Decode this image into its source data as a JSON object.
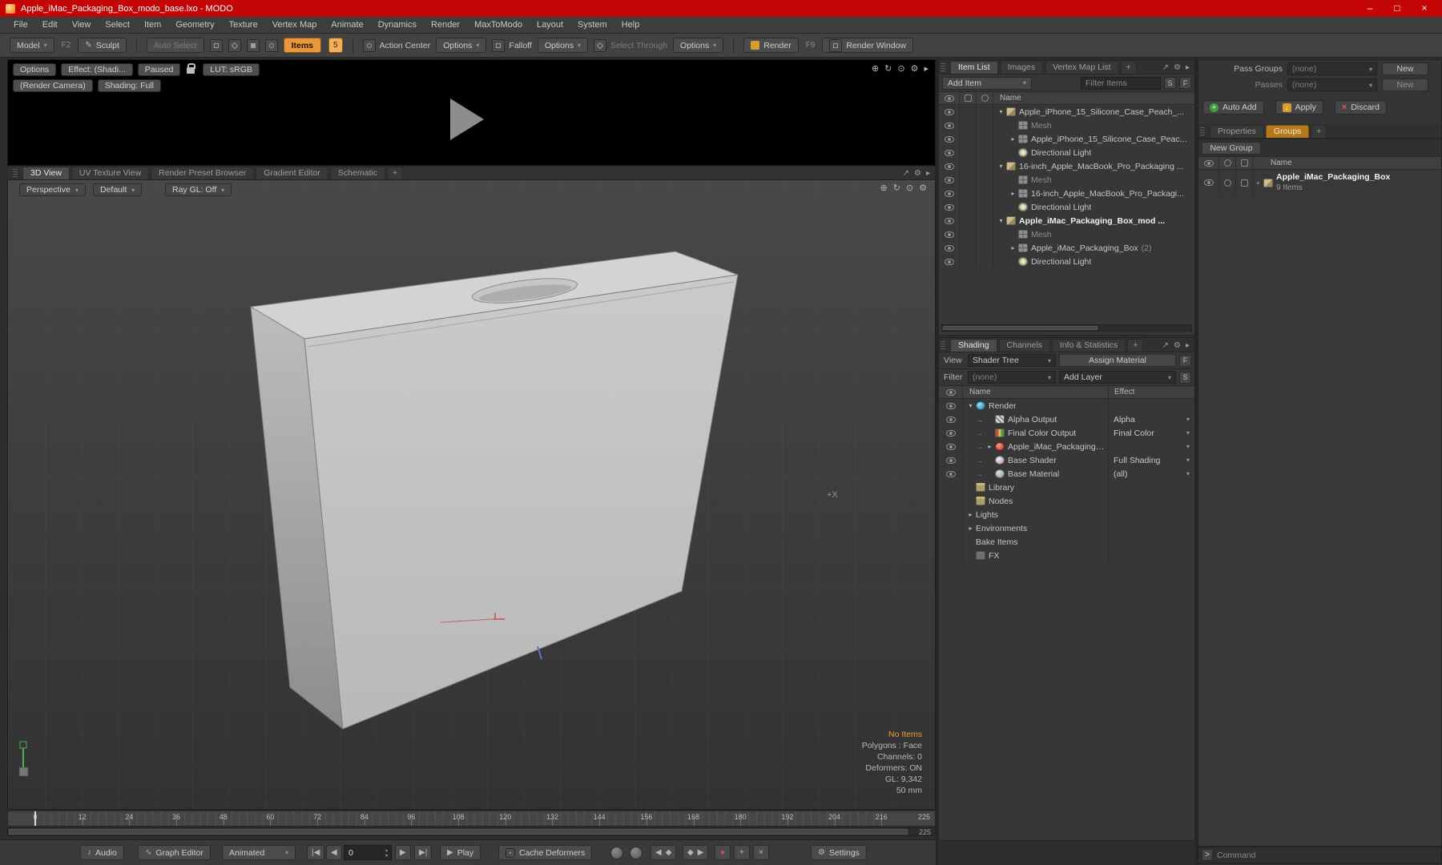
{
  "window": {
    "title": "Apple_iMac_Packaging_Box_modo_base.lxo - MODO"
  },
  "menu": [
    "File",
    "Edit",
    "View",
    "Select",
    "Item",
    "Geometry",
    "Texture",
    "Vertex Map",
    "Animate",
    "Dynamics",
    "Render",
    "MaxToModo",
    "Layout",
    "System",
    "Help"
  ],
  "toolbar": {
    "model": "Model",
    "model_key": "F2",
    "sculpt": "Sculpt",
    "auto_select": "Auto Select",
    "items": "Items",
    "items_key": "5",
    "action_center": "Action Center",
    "options_a": "Options",
    "falloff": "Falloff",
    "options_b": "Options",
    "select_through": "Select Through",
    "options_c": "Options",
    "render": "Render",
    "render_key": "F9",
    "render_window": "Render Window"
  },
  "preview": {
    "options": "Options",
    "effect": "Effect: (Shadi...",
    "paused": "Paused",
    "lut": "LUT: sRGB",
    "render_camera": "(Render Camera)",
    "shading_full": "Shading: Full"
  },
  "viewport_tabs": [
    "3D View",
    "UV Texture View",
    "Render Preset Browser",
    "Gradient Editor",
    "Schematic",
    "+"
  ],
  "viewport": {
    "camera": "Perspective",
    "style": "Default",
    "raygl": "Ray GL: Off",
    "axis_label": "+X",
    "status": [
      "No Items",
      "Polygons : Face",
      "Channels: 0",
      "Deformers: ON",
      "GL: 9,342",
      "50 mm"
    ]
  },
  "timeline": {
    "ticks": [
      0,
      12,
      24,
      36,
      48,
      60,
      72,
      84,
      96,
      108,
      120,
      132,
      144,
      156,
      168,
      180,
      192,
      204,
      216
    ],
    "end": "225",
    "range_end": "225"
  },
  "transport": {
    "audio": "Audio",
    "graph_editor": "Graph Editor",
    "animated": "Animated",
    "frame": "0",
    "play": "Play",
    "cache_deformers": "Cache Deformers",
    "settings": "Settings"
  },
  "item_list": {
    "tabs": [
      "Item List",
      "Images",
      "Vertex Map List",
      "+"
    ],
    "add_item": "Add Item",
    "filter_placeholder": "Filter Items",
    "s": "S",
    "f": "F",
    "header": "Name",
    "rows": [
      {
        "d": 0,
        "x": "v",
        "i": "group",
        "t": "Apple_iPhone_15_Silicone_Case_Peach_..."
      },
      {
        "d": 1,
        "i": "mesh",
        "t": "Mesh",
        "dim": 1
      },
      {
        "d": 1,
        "x": ">",
        "i": "mesh",
        "t": "Apple_iPhone_15_Silicone_Case_Peac..."
      },
      {
        "d": 1,
        "i": "light",
        "t": "Directional Light"
      },
      {
        "d": 0,
        "x": "v",
        "i": "group",
        "t": "16-inch_Apple_MacBook_Pro_Packaging ..."
      },
      {
        "d": 1,
        "i": "mesh",
        "t": "Mesh",
        "dim": 1
      },
      {
        "d": 1,
        "x": ">",
        "i": "mesh",
        "t": "16-inch_Apple_MacBook_Pro_Packagi..."
      },
      {
        "d": 1,
        "i": "light",
        "t": "Directional Light"
      },
      {
        "d": 0,
        "x": "v",
        "i": "group",
        "t": "Apple_iMac_Packaging_Box_mod ...",
        "bold": 1
      },
      {
        "d": 1,
        "i": "mesh",
        "t": "Mesh",
        "dim": 1
      },
      {
        "d": 1,
        "x": ">",
        "i": "mesh",
        "t": "Apple_iMac_Packaging_Box",
        "sfx": "(2)"
      },
      {
        "d": 1,
        "i": "light",
        "t": "Directional Light"
      }
    ]
  },
  "shading": {
    "tabs": [
      "Shading",
      "Channels",
      "Info & Statistics",
      "+"
    ],
    "view_label": "View",
    "view_value": "Shader Tree",
    "assign_material": "Assign Material",
    "f": "F",
    "filter_label": "Filter",
    "filter_value": "(none)",
    "add_layer": "Add Layer",
    "s": "S",
    "header_name": "Name",
    "header_effect": "Effect",
    "rows": [
      {
        "d": 0,
        "x": "v",
        "i": "render",
        "t": "Render",
        "eye": 1
      },
      {
        "d": 1,
        "i": "alpha",
        "t": "Alpha Output",
        "e": "Alpha",
        "eye": 1,
        "c": 1
      },
      {
        "d": 1,
        "i": "fcolor",
        "t": "Final Color Output",
        "e": "Final Color",
        "eye": 1,
        "c": 1
      },
      {
        "d": 1,
        "x": ">",
        "i": "mat",
        "t": "Apple_iMac_Packaging_Bo ...",
        "e": "",
        "eye": 1,
        "c": 1
      },
      {
        "d": 1,
        "i": "shader",
        "t": "Base Shader",
        "e": "Full Shading",
        "eye": 1,
        "c": 1
      },
      {
        "d": 1,
        "i": "bmat",
        "t": "Base Material",
        "e": "(all)",
        "eye": 1,
        "c": 1
      },
      {
        "d": 0,
        "i": "folder",
        "t": "Library"
      },
      {
        "d": 0,
        "i": "folder",
        "t": "Nodes"
      },
      {
        "d": 0,
        "x": ">",
        "t": "Lights"
      },
      {
        "d": 0,
        "x": ">",
        "t": "Environments"
      },
      {
        "d": 0,
        "t": "Bake Items"
      },
      {
        "d": 0,
        "i": "fx",
        "t": "FX"
      }
    ]
  },
  "groups_panel": {
    "pass_groups_label": "Pass Groups",
    "pass_groups_value": "(none)",
    "pass_groups_new": "New",
    "passes_label": "Passes",
    "passes_value": "(none)",
    "passes_new": "New",
    "auto_add": "Auto Add",
    "apply": "Apply",
    "discard": "Discard",
    "tabs": [
      "Properties",
      "Groups",
      "+"
    ],
    "new_group": "New Group",
    "header": "Name",
    "group_name": "Apple_iMac_Packaging_Box",
    "group_count": "9 Items"
  },
  "command": {
    "prompt": ">",
    "placeholder": "Command"
  },
  "colors": {
    "accent": "#e8973a",
    "titlebar": "#c30505",
    "status_orange": "#e79b3b"
  },
  "icons": {
    "minimize": "–",
    "maximize": "□",
    "close": "×",
    "gear": "⚙",
    "expand": "↗",
    "panel_arrow": "▸",
    "chevron": "▾",
    "tri_down": "▾",
    "tri_right": "▸",
    "move": "⊕",
    "rotate": "↻",
    "zoom": "⊙",
    "play": "▶",
    "music": "♪",
    "wave": "∿",
    "pencil": "✎",
    "goto_start": "|◀",
    "prev": "◀",
    "next": "▶",
    "goto_end": "▶|",
    "key": "◆",
    "record": "●",
    "plus": "+",
    "cross": "×",
    "down_arrow": "↓",
    "connector": "→"
  }
}
